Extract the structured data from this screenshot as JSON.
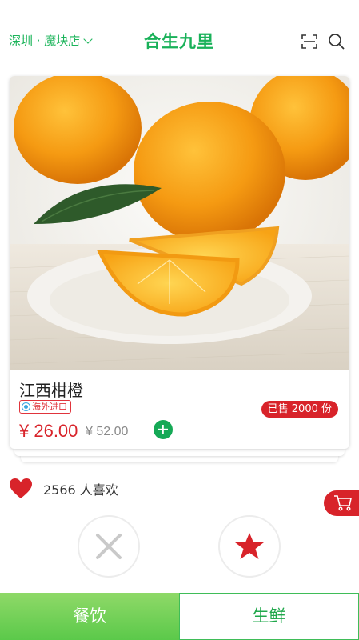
{
  "header": {
    "location": "深圳 · 魔块店",
    "brand": "合生九里"
  },
  "product": {
    "name": "江西柑橙",
    "tag": "海外进口",
    "sold": "已售 2000 份",
    "price": "¥ 26.00",
    "original_price": "¥ 52.00"
  },
  "social": {
    "likes": "2566 人喜欢"
  },
  "bottom_nav": {
    "tabs": [
      {
        "label": "餐饮"
      },
      {
        "label": "生鲜"
      }
    ]
  },
  "colors": {
    "brand_green": "#1bb45a",
    "accent_red": "#d8232a"
  },
  "icons": [
    "chevron-down-icon",
    "scan-icon",
    "search-icon",
    "import-globe-icon",
    "plus-icon",
    "heart-icon",
    "cart-icon",
    "close-icon",
    "star-icon"
  ]
}
